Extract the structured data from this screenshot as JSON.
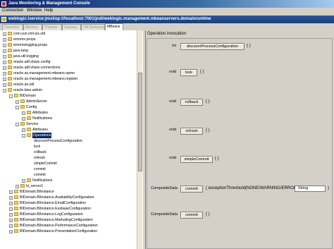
{
  "window": {
    "title": "Java Monitoring & Management Console"
  },
  "menu": {
    "items": [
      "Connection",
      "Window",
      "Help"
    ]
  },
  "connection_tab": {
    "label": "weblogic:iservice:jmxiiop:///localhost:7001/jndi/weblogic.management.mbeanservers.domainruntime"
  },
  "inner_tabs": [
    "Overview",
    "Memory",
    "Threads",
    "Classes",
    "VM Summary",
    "MBeans"
  ],
  "active_inner_tab": "MBeans",
  "tree": {
    "nodes": [
      {
        "label": "com.sun.xml.ws.util",
        "depth": 0,
        "expander": "+"
      },
      {
        "label": "emoms.props",
        "depth": 0,
        "expander": "+"
      },
      {
        "label": "emomslogging.props",
        "depth": 0,
        "expander": "+"
      },
      {
        "label": "java.lang",
        "depth": 0,
        "expander": "+"
      },
      {
        "label": "java.util.logging",
        "depth": 0,
        "expander": "+"
      },
      {
        "label": "oracle.adf.share.config",
        "depth": 0,
        "expander": "+"
      },
      {
        "label": "oracle.adf.share.connections",
        "depth": 0,
        "expander": "+"
      },
      {
        "label": "oracle.as.management.mbeans.opmn",
        "depth": 0,
        "expander": "+"
      },
      {
        "label": "oracle.as.management.mbeans.register",
        "depth": 0,
        "expander": "+"
      },
      {
        "label": "oracle.as.util",
        "depth": 0,
        "expander": "+"
      },
      {
        "label": "oracle.biee.admin",
        "depth": 0,
        "expander": "-"
      },
      {
        "label": "BIDomain",
        "depth": 1,
        "expander": "-"
      },
      {
        "label": "AdminServer",
        "depth": 2,
        "expander": "+"
      },
      {
        "label": "Config",
        "depth": 2,
        "expander": "-"
      },
      {
        "label": "Attributes",
        "depth": 3,
        "expander": "+"
      },
      {
        "label": "Notifications",
        "depth": 3,
        "expander": "+"
      },
      {
        "label": "Service",
        "depth": 2,
        "expander": "-"
      },
      {
        "label": "Attributes",
        "depth": 3,
        "expander": "+"
      },
      {
        "label": "Operations",
        "depth": 3,
        "expander": "-",
        "selected": true
      },
      {
        "label": "discoverProcessConfiguration",
        "depth": 4,
        "expander": ""
      },
      {
        "label": "lock",
        "depth": 4,
        "expander": ""
      },
      {
        "label": "rollback",
        "depth": 4,
        "expander": ""
      },
      {
        "label": "refresh",
        "depth": 4,
        "expander": ""
      },
      {
        "label": "simpleCommit",
        "depth": 4,
        "expander": ""
      },
      {
        "label": "commit",
        "depth": 4,
        "expander": ""
      },
      {
        "label": "commit",
        "depth": 4,
        "expander": ""
      },
      {
        "label": "Notifications",
        "depth": 3,
        "expander": "+"
      },
      {
        "label": "bi_server1",
        "depth": 2,
        "expander": "+"
      },
      {
        "label": "BIDomain.BIInstance",
        "depth": 1,
        "expander": "+"
      },
      {
        "label": "BIDomain.BIInstance.AvailabilityConfiguration",
        "depth": 1,
        "expander": "+"
      },
      {
        "label": "BIDomain.BIInstance.EmailConfiguration",
        "depth": 1,
        "expander": "+"
      },
      {
        "label": "BIDomain.BIInstance.EssbaseConfiguration",
        "depth": 1,
        "expander": "+"
      },
      {
        "label": "BIDomain.BIInstance.LogConfiguration",
        "depth": 1,
        "expander": "+"
      },
      {
        "label": "BIDomain.BIInstance.MarketingConfiguration",
        "depth": 1,
        "expander": "+"
      },
      {
        "label": "BIDomain.BIInstance.PerformanceConfiguration",
        "depth": 1,
        "expander": "+"
      },
      {
        "label": "BIDomain.BIInstance.PresentationConfiguration",
        "depth": 1,
        "expander": "+"
      }
    ]
  },
  "operations_panel": {
    "header": "Operation invocation",
    "operations": [
      {
        "return_type": "int",
        "name": "discoverProcessConfiguration",
        "params": "( )"
      },
      {
        "return_type": "void",
        "name": "lock",
        "params": "( )"
      },
      {
        "return_type": "void",
        "name": "rollback",
        "params": "( )"
      },
      {
        "return_type": "void",
        "name": "refresh",
        "params": "( )"
      },
      {
        "return_type": "void",
        "name": "simpleCommit",
        "params": "( )"
      },
      {
        "return_type": "CompositeData",
        "name": "commit",
        "params": "( exceptionThreshold(NONE/WARNING/ERROR)",
        "param_value": "String",
        "params_close": ")"
      },
      {
        "return_type": "CompositeData",
        "name": "commit",
        "params": "( )"
      }
    ]
  }
}
